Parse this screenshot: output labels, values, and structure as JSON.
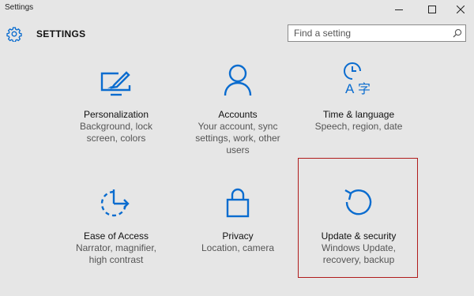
{
  "window": {
    "title": "Settings",
    "controls": [
      "minimize",
      "maximize",
      "close"
    ]
  },
  "header": {
    "icon": "gear-icon",
    "label": "SETTINGS"
  },
  "search": {
    "placeholder": "Find a setting",
    "value": "",
    "icon": "search-icon"
  },
  "colors": {
    "accent": "#0a6ccf",
    "background": "#e6e6e6",
    "highlight_border": "#b01c1c"
  },
  "tiles": [
    {
      "name": "Personalization",
      "description": "Background, lock screen, colors",
      "icon": "personalization-icon"
    },
    {
      "name": "Accounts",
      "description": "Your account, sync settings, work, other users",
      "icon": "person-icon"
    },
    {
      "name": "Time & language",
      "description": "Speech, region, date",
      "icon": "time-language-icon"
    },
    {
      "name": "Ease of Access",
      "description": "Narrator, magnifier, high contrast",
      "icon": "ease-of-access-icon"
    },
    {
      "name": "Privacy",
      "description": "Location, camera",
      "icon": "lock-icon"
    },
    {
      "name": "Update & security",
      "description": "Windows Update, recovery, backup",
      "icon": "update-icon",
      "highlighted": true
    }
  ]
}
